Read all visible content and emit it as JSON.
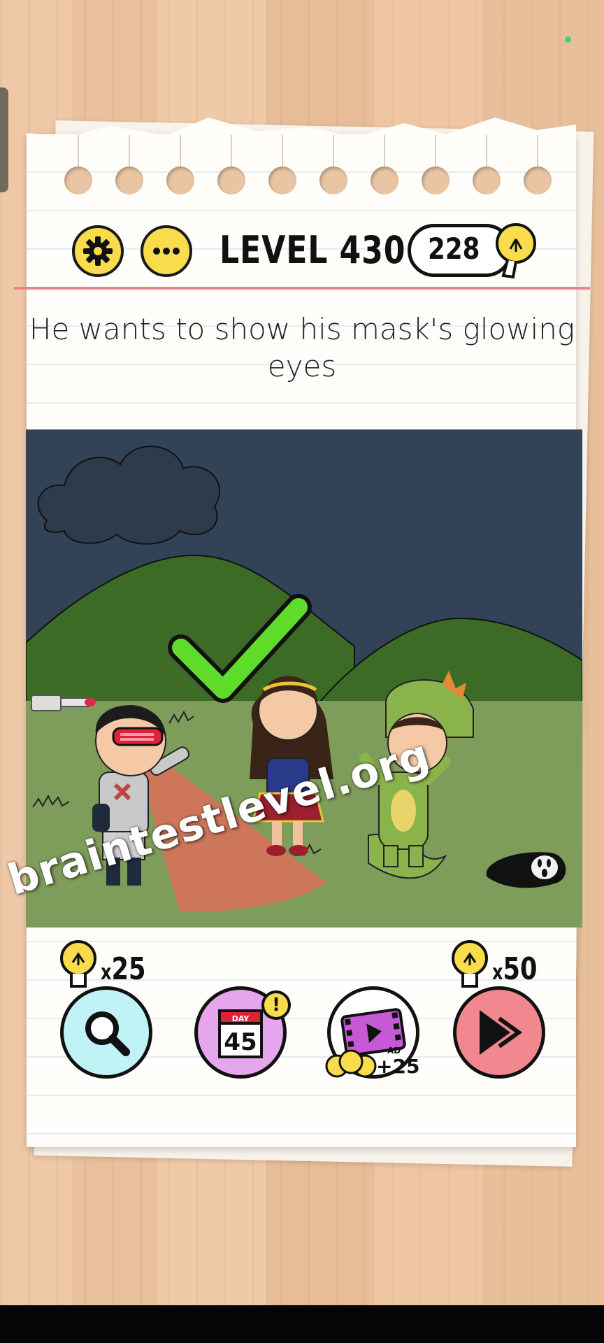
{
  "header": {
    "settings_icon": "gear-icon",
    "menu_icon": "ellipsis-icon",
    "level_label": "LEVEL 430",
    "hint_count": "228",
    "hint_icon": "lightbulb-icon"
  },
  "question": {
    "text": "He wants to show his mask's glowing eyes"
  },
  "scene": {
    "result_icon": "checkmark-icon",
    "watermark": "braintestlevel.org"
  },
  "tools": {
    "search": {
      "cost": "25",
      "cost_prefix": "x",
      "icon": "magnifier-icon"
    },
    "daily": {
      "day_label": "DAY",
      "day_number": "45",
      "badge": "!",
      "icon": "calendar-icon"
    },
    "ad": {
      "label": "AD",
      "reward": "+25",
      "icon": "video-icon"
    },
    "skip": {
      "cost": "50",
      "cost_prefix": "x",
      "icon": "skip-icon"
    }
  },
  "colors": {
    "accent_yellow": "#f8dc4c",
    "check_green": "#5fdc2a",
    "rule_red": "#e8848e",
    "search_bg": "#bff3f6",
    "daily_bg": "#e5a6ee",
    "skip_bg": "#f2878f"
  }
}
